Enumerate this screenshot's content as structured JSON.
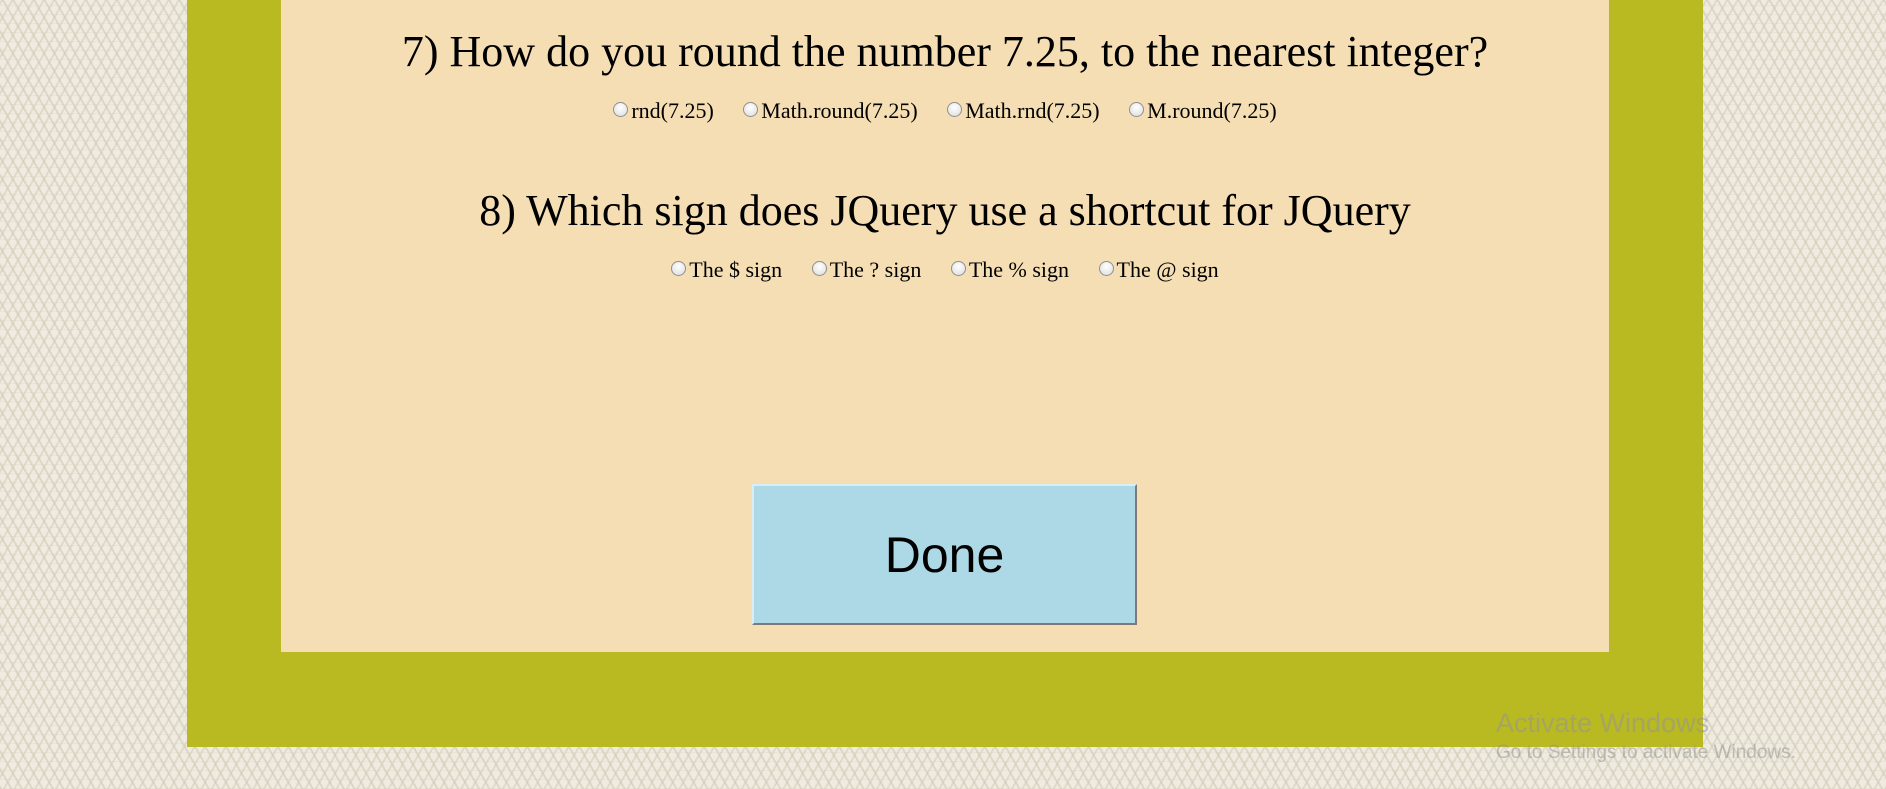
{
  "quiz": {
    "questions": [
      {
        "text": "7) How do you round the number 7.25, to the nearest integer?",
        "options": [
          "rnd(7.25)",
          "Math.round(7.25)",
          "Math.rnd(7.25)",
          "M.round(7.25)"
        ]
      },
      {
        "text": "8) Which sign does JQuery use a shortcut for JQuery",
        "options": [
          "The $ sign",
          "The ? sign",
          "The % sign",
          "The @ sign"
        ]
      }
    ],
    "done_label": "Done"
  },
  "watermark": {
    "title": "Activate Windows",
    "subtitle": "Go to Settings to activate Windows."
  },
  "colors": {
    "outer_frame": "#b9b922",
    "panel": "#f5deb3",
    "button": "#add8e6"
  }
}
